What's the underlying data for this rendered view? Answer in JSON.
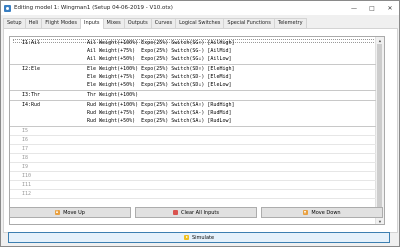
{
  "window": {
    "title": "Editing model 1: Wingman1  (Setup 04-06-2019 - V10.otx)",
    "minimize": "—",
    "maximize": "□",
    "close": "✕"
  },
  "tabs": [
    "Setup",
    "Heli",
    "Flight Modes",
    "Inputs",
    "Mixes",
    "Outputs",
    "Curves",
    "Logical Switches",
    "Special Functions",
    "Telemetry"
  ],
  "active_tab": "Inputs",
  "inputs": [
    {
      "channel": "I1:Ail",
      "lines": [
        "Ail Weight(+100%) Expo(25%) Switch(SG↑) [AilHigh]",
        "Ail Weight(+75%)  Expo(25%) Switch(SG-) [AilMid]",
        "Ail Weight(+50%)  Expo(25%) Switch(SG↓) [AilLow]"
      ]
    },
    {
      "channel": "I2:Ele",
      "lines": [
        "Ele Weight(+100%) Expo(25%) Switch(SD↑) [EleHigh]",
        "Ele Weight(+75%)  Expo(25%) Switch(SD-) [EleMid]",
        "Ele Weight(+50%)  Expo(25%) Switch(SD↓) [EleLow]"
      ]
    },
    {
      "channel": "I3:Thr",
      "lines": [
        "Thr Weight(+100%)"
      ]
    },
    {
      "channel": "I4:Rud",
      "lines": [
        "Rud Weight(+100%) Expo(25%) Switch(SA↑) [RudHigh]",
        "Rud Weight(+75%)  Expo(25%) Switch(SA-) [RudMid]",
        "Rud Weight(+50%)  Expo(25%) Switch(SA↓) [RudLow]"
      ]
    }
  ],
  "empty_inputs": [
    "I5",
    "I6",
    "I7",
    "I8",
    "I9",
    "I10",
    "I11",
    "I12"
  ],
  "buttons": {
    "move_up": "Move Up",
    "clear_all": "Clear All Inputs",
    "move_down": "Move Down",
    "simulate": "Simulate"
  },
  "icons": {
    "app": "radio-transmitter-icon",
    "move_up": "arrow-up-icon",
    "clear_all": "clear-icon",
    "move_down": "arrow-down-icon",
    "simulate": "play-icon"
  }
}
